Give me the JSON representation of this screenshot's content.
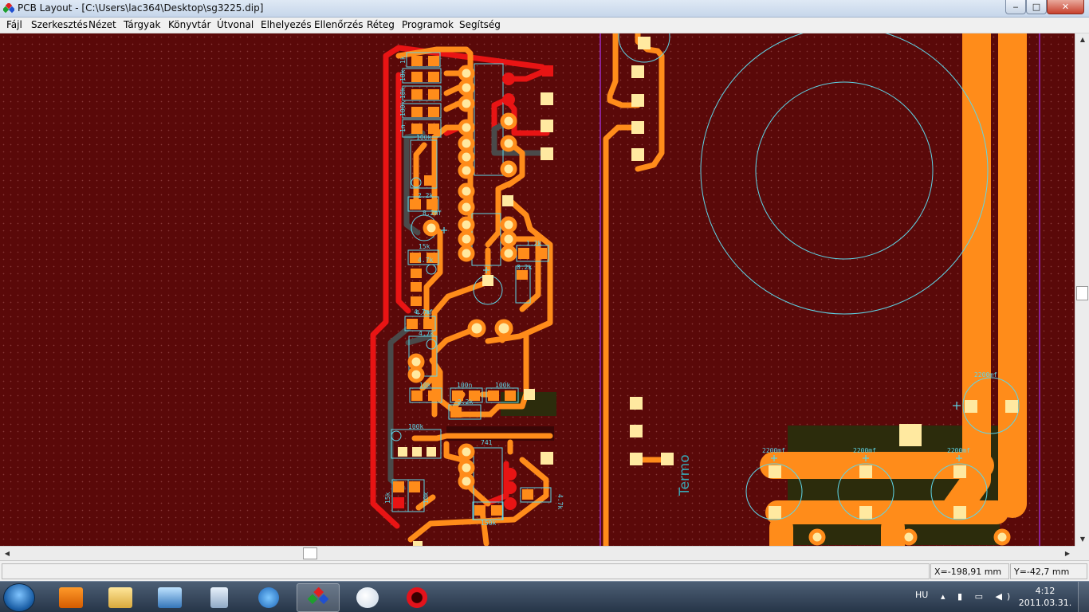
{
  "window": {
    "title": "PCB Layout - [C:\\Users\\lac364\\Desktop\\sg3225.dip]",
    "min_label": "‒",
    "max_label": "□",
    "close_label": "✕"
  },
  "menu": [
    "Fájl",
    "Szerkesztés",
    "Nézet",
    "Tárgyak",
    "Könyvtár",
    "Útvonal",
    "Elhelyezés",
    "Ellenőrzés",
    "Réteg",
    "Programok",
    "Segítség"
  ],
  "board": {
    "labels": [
      "1k",
      "18k",
      "18k",
      "100k",
      "1n",
      "100k",
      "2.2k",
      "1.2k",
      "15k",
      "4.7k",
      "8.2k",
      "8.2mf",
      "4.7k",
      "4.7mf",
      "4.7k",
      "10k",
      "100n",
      "100k",
      "2.2k",
      "100k",
      "741",
      "150k",
      "4.7k",
      "15k",
      "10k",
      "Termo",
      "2200mf",
      "2200mf",
      "2200mf",
      "2200mf"
    ],
    "colors": {
      "background": "#5a0909",
      "top_trace": "#ff8c1a",
      "bottom_trace": "#e81414",
      "grey_trace": "#4a4a4a",
      "pad": "#ffe9a0",
      "outline": "#5fd6e8",
      "board_edge": "#9b2cc4",
      "ground_plane": "#2c2c0c"
    }
  },
  "status": {
    "x": "X=-198,91 mm",
    "y": "Y=-42,7 mm"
  },
  "taskbar": {
    "apps": [
      "Windows Media Player",
      "Windows Explorer",
      "Remote Desktop",
      "Calculator",
      "Internet Explorer",
      "PCB Layout",
      "Paint",
      "Opera"
    ],
    "active_app": "PCB Layout",
    "language": "HU",
    "tray": "▴ ▮ ▭ ◀)",
    "time": "4:12",
    "date": "2011.03.31."
  }
}
